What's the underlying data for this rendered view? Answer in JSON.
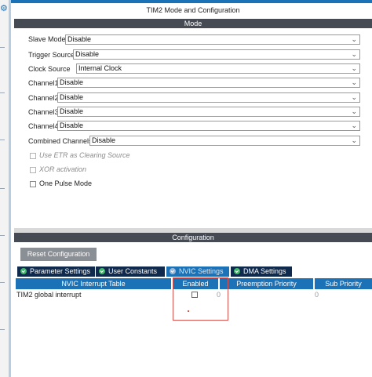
{
  "page_title": "TIM2 Mode and Configuration",
  "mode": {
    "header": "Mode",
    "fields": [
      {
        "label": "Slave Mode",
        "value": "Disable"
      },
      {
        "label": "Trigger Source",
        "value": "Disable"
      },
      {
        "label": "Clock Source",
        "value": "Internal Clock"
      },
      {
        "label": "Channel1",
        "value": "Disable"
      },
      {
        "label": "Channel2",
        "value": "Disable"
      },
      {
        "label": "Channel3",
        "value": "Disable"
      },
      {
        "label": "Channel4",
        "value": "Disable"
      },
      {
        "label": "Combined Channels",
        "value": "Disable"
      }
    ],
    "checkboxes": [
      {
        "label": "Use ETR as Clearing Source",
        "enabled": false,
        "checked": false
      },
      {
        "label": "XOR activation",
        "enabled": false,
        "checked": false
      },
      {
        "label": "One Pulse Mode",
        "enabled": true,
        "checked": false
      }
    ]
  },
  "configuration": {
    "header": "Configuration",
    "reset_button": "Reset Configuration",
    "tabs": [
      {
        "label": "Parameter Settings",
        "active": false
      },
      {
        "label": "User Constants",
        "active": false
      },
      {
        "label": "NVIC Settings",
        "active": true
      },
      {
        "label": "DMA Settings",
        "active": false
      }
    ],
    "table": {
      "columns": [
        "NVIC Interrupt Table",
        "Enabled",
        "Preemption Priority",
        "Sub Priority"
      ],
      "rows": [
        {
          "name": "TIM2 global interrupt",
          "enabled": false,
          "preemption": "0",
          "sub": "0"
        }
      ]
    }
  },
  "colors": {
    "accent": "#1c72b7",
    "header": "#454a53",
    "tab": "#0f2a4d",
    "highlight": "#d9534f"
  },
  "icons": {
    "settings": "gear-icon",
    "tab_status": "check-circle-icon",
    "dropdown": "chevron-down-icon"
  }
}
